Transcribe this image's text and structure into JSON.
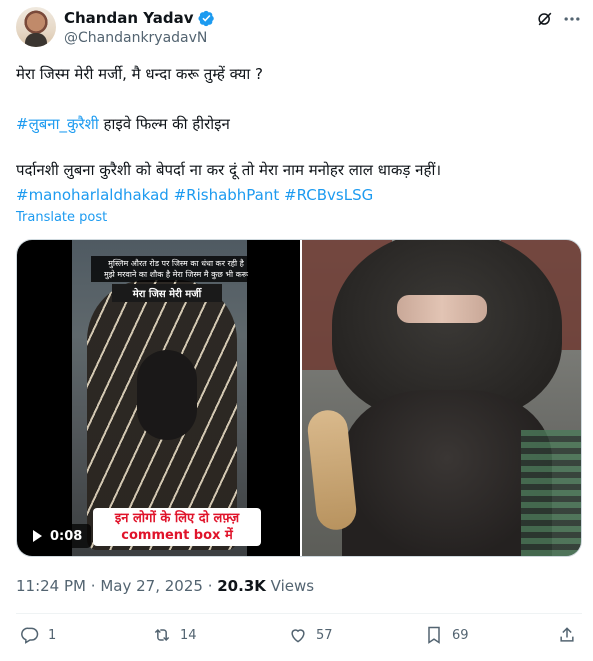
{
  "author": {
    "name": "Chandan Yadav",
    "handle": "@ChandankryadavN"
  },
  "post": {
    "line1": "मेरा जिस्म मेरी मर्जी, मै धन्दा करू तुम्हें क्या ?",
    "line2_hashtag": "#लुबना_कुरैशी",
    "line2_rest": " हाइवे फिल्म की हीरोइन",
    "line3": "पर्दानशी  लुबना कुरैशी  को बेपर्दा ना कर दूं तो मेरा नाम मनोहर लाल धाकड़ नहीं।",
    "hashtags": [
      "#manoharlaldhakad",
      "#RishabhPant",
      "#RCBvsLSG"
    ],
    "translate_label": "Translate post"
  },
  "media": {
    "video_caption_top_l1": "मुस्लिम औरत रोड पर जिस्म का धंधा कर रही है",
    "video_caption_top_l2": "मुझे मरवाने का शौक है मेरा जिस्म मै कुछ भी करू",
    "video_caption_bold": "मेरा जिस मेरी मर्जी",
    "video_caption_bottom_l1": "इन लोगों के लिए दो लफ़्ज़",
    "video_caption_bottom_l2": "comment box में",
    "video_duration": "0:08"
  },
  "meta": {
    "time": "11:24 PM",
    "separator": "·",
    "date": "May 27, 2025",
    "views_count": "20.3K",
    "views_label": "Views"
  },
  "actions": {
    "replies": "1",
    "reposts": "14",
    "likes": "57",
    "bookmarks": "69"
  },
  "colors": {
    "accent": "#1d9bf0",
    "text": "#0f1419",
    "muted": "#536471"
  }
}
